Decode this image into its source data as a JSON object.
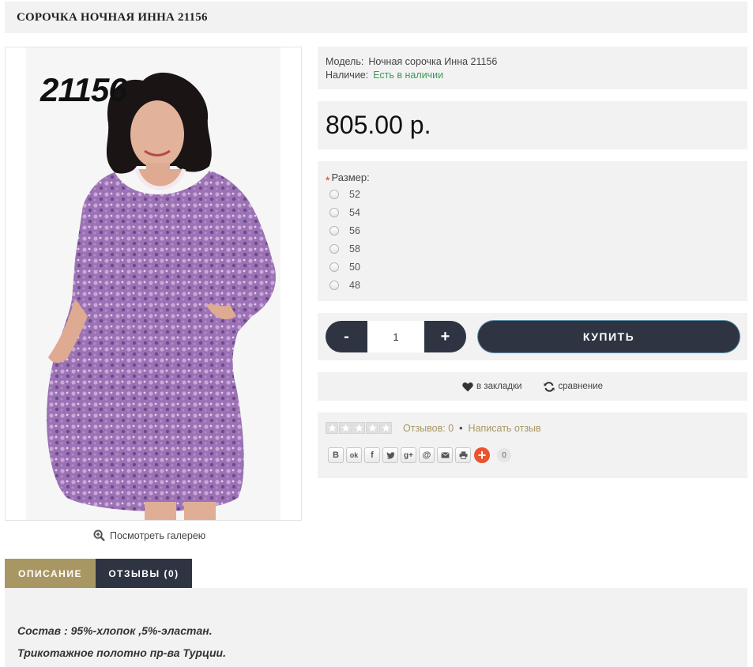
{
  "product": {
    "title": "СОРОЧКА НОЧНАЯ ИННА 21156",
    "image_number": "21156",
    "gallery_label": "Посмотреть галерею"
  },
  "info": {
    "model_label": "Модель:",
    "model_value": "Ночная сорочка Инна 21156",
    "stock_label": "Наличие:",
    "stock_value": "Есть в наличии"
  },
  "price": "805.00 р.",
  "options": {
    "required_mark": "*",
    "label": "Размер:",
    "sizes": [
      "52",
      "54",
      "56",
      "58",
      "50",
      "48"
    ]
  },
  "purchase": {
    "minus": "-",
    "plus": "+",
    "quantity": "1",
    "buy_label": "КУПИТЬ"
  },
  "links": {
    "wishlist": "в закладки",
    "compare": "сравнение"
  },
  "reviews": {
    "rating": 0,
    "max_rating": 5,
    "count_label": "Отзывов: 0",
    "separator": "•",
    "write_label": "Написать отзыв"
  },
  "share": {
    "buttons": [
      "vk-icon",
      "odnoklassniki-icon",
      "facebook-icon",
      "twitter-icon",
      "google-plus-icon",
      "mail-at-icon",
      "email-icon",
      "print-icon"
    ],
    "labels": {
      "vk": "В",
      "ok": "ok",
      "fb": "f",
      "gp": "g+",
      "at": "@"
    },
    "plus": "+",
    "count": "0"
  },
  "tabs": {
    "description": "ОПИСАНИЕ",
    "reviews": "ОТЗЫВЫ (0)"
  },
  "description": {
    "line1": "Состав : 95%-хлопок ,5%-эластан.",
    "line2": "Трикотажное полотно пр-ва Турции."
  },
  "colors": {
    "accent": "#a89763",
    "dark": "#2f3443",
    "stock": "#3b9a57",
    "panel": "#f2f2f2"
  }
}
